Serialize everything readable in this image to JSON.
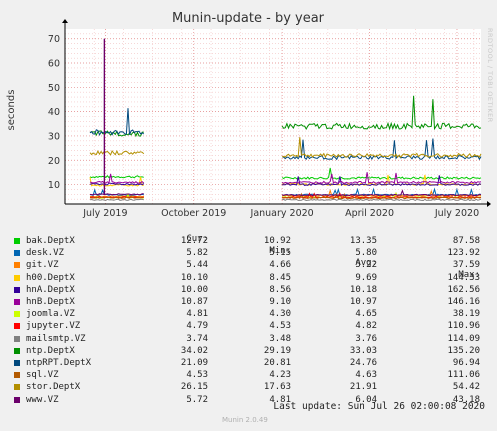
{
  "chart_data": {
    "type": "line",
    "title": "Munin-update - by year",
    "ylabel": "seconds",
    "ylim": [
      2,
      74
    ],
    "yticks": [
      10,
      20,
      30,
      40,
      50,
      60,
      70
    ],
    "xlim": [
      "2019-05-20",
      "2020-07-26"
    ],
    "xticks": [
      {
        "label": "July 2019",
        "date": "2019-07-01"
      },
      {
        "label": "October 2019",
        "date": "2019-10-01"
      },
      {
        "label": "January 2020",
        "date": "2020-01-01"
      },
      {
        "label": "April 2020",
        "date": "2020-04-01"
      },
      {
        "label": "July 2020",
        "date": "2020-07-01"
      }
    ],
    "grid": true,
    "watermark": "RRDTOOL / TOBI OETIKER",
    "columns": [
      "Cur:",
      "Min:",
      "Avg:",
      "Max:"
    ],
    "series": [
      {
        "name": "bak.DeptX",
        "color": "#00cc00",
        "cur": "12.72",
        "min": "10.92",
        "avg": "13.35",
        "max": "87.58",
        "level1": 13.2,
        "level2": 12.7
      },
      {
        "name": "desk.VZ",
        "color": "#0066b3",
        "cur": "5.82",
        "min": "5.15",
        "avg": "5.80",
        "max": "123.92",
        "level1": 5.8,
        "level2": 5.8
      },
      {
        "name": "git.VZ",
        "color": "#ff8000",
        "cur": "5.44",
        "min": "4.66",
        "avg": "5.22",
        "max": "37.59",
        "level1": 5.1,
        "level2": 5.4
      },
      {
        "name": "h00.DeptX",
        "color": "#ffcc00",
        "cur": "10.10",
        "min": "8.45",
        "avg": "9.69",
        "max": "144.33",
        "level1": 9.7,
        "level2": 10.1
      },
      {
        "name": "hnA.DeptX",
        "color": "#330099",
        "cur": "10.00",
        "min": "8.56",
        "avg": "10.18",
        "max": "162.56",
        "level1": 10.2,
        "level2": 10.0
      },
      {
        "name": "hnB.DeptX",
        "color": "#990099",
        "cur": "10.87",
        "min": "9.10",
        "avg": "10.97",
        "max": "146.16",
        "level1": 10.9,
        "level2": 10.9
      },
      {
        "name": "joomla.VZ",
        "color": "#ccff00",
        "cur": "4.81",
        "min": "4.30",
        "avg": "4.65",
        "max": "38.19",
        "level1": 4.6,
        "level2": 4.8
      },
      {
        "name": "jupyter.VZ",
        "color": "#ff0000",
        "cur": "4.79",
        "min": "4.53",
        "avg": "4.82",
        "max": "110.96",
        "level1": 4.8,
        "level2": 4.8
      },
      {
        "name": "mailsmtp.VZ",
        "color": "#808080",
        "cur": "3.74",
        "min": "3.48",
        "avg": "3.76",
        "max": "114.09",
        "level1": 3.7,
        "level2": 3.7
      },
      {
        "name": "ntp.DeptX",
        "color": "#008f00",
        "cur": "34.02",
        "min": "29.19",
        "avg": "33.03",
        "max": "135.20",
        "level1": 31.0,
        "level2": 34.0
      },
      {
        "name": "ntpRPT.DeptX",
        "color": "#00487d",
        "cur": "21.09",
        "min": "20.81",
        "avg": "24.76",
        "max": "96.94",
        "level1": 31.5,
        "level2": 21.1
      },
      {
        "name": "sql.VZ",
        "color": "#b35a00",
        "cur": "4.53",
        "min": "4.23",
        "avg": "4.63",
        "max": "111.06",
        "level1": 4.6,
        "level2": 4.5
      },
      {
        "name": "stor.DeptX",
        "color": "#b38f00",
        "cur": "26.15",
        "min": "17.63",
        "avg": "21.91",
        "max": "54.42",
        "level1": 23.0,
        "level2": 22.0
      },
      {
        "name": "www.VZ",
        "color": "#6b006b",
        "cur": "5.72",
        "min": "4.81",
        "avg": "6.04",
        "max": "43.18",
        "level1": 6.0,
        "level2": 5.7
      }
    ],
    "active_periods": [
      [
        "2019-06-15",
        "2019-08-10"
      ],
      [
        "2020-01-01",
        "2020-07-26"
      ]
    ],
    "spike": {
      "series": "www.VZ",
      "date": "2019-06-30",
      "value": 70
    }
  },
  "footer": {
    "last_update": "Last update: Sun Jul 26 02:00:08 2020",
    "version": "Munin 2.0.49"
  }
}
